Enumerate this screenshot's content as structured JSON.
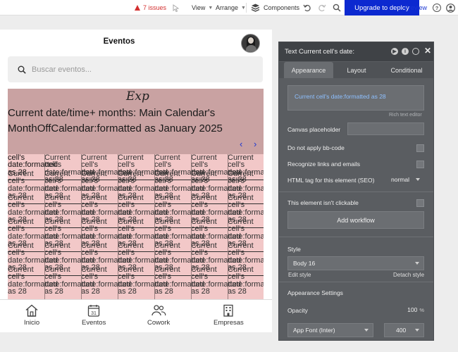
{
  "toolbar": {
    "issues": "7 issues",
    "view": "View",
    "arrange": "Arrange",
    "components": "Components",
    "deploy": "Upgrade to deploy",
    "preview": "Preview"
  },
  "app": {
    "title": "Eventos",
    "search_placeholder": "Buscar eventos...",
    "calendar": {
      "exp_text": "Exp",
      "month_text": "Current date/time+ months: Main Calendar's MonthOffCalendar:formatted as January 2025",
      "prev_arrow": "‹",
      "next_arrow": "›",
      "cell_text": "Current cell's date:formatted as 28",
      "first_cell_text": "cell's date:formatted as 28"
    },
    "bottom_nav": [
      {
        "label": "Inicio",
        "icon": "home-icon"
      },
      {
        "label": "Eventos",
        "icon": "calendar-icon",
        "badge": "31"
      },
      {
        "label": "Cowork",
        "icon": "people-icon"
      },
      {
        "label": "Empresas",
        "icon": "building-icon"
      }
    ]
  },
  "panel": {
    "title": "Text Current cell's date:",
    "tabs": [
      "Appearance",
      "Layout",
      "Conditional"
    ],
    "active_tab": "Appearance",
    "expression": "Current cell's date:formatted as 28",
    "rich_text_editor": "Rich text editor",
    "canvas_placeholder_label": "Canvas placeholder",
    "do_not_apply_bbcode": "Do not apply bb-code",
    "recognize_links": "Recognize links and emails",
    "html_tag_label": "HTML tag for this element (SEO)",
    "html_tag_value": "normal",
    "not_clickable": "This element isn't clickable",
    "add_workflow": "Add workflow",
    "style_label": "Style",
    "style_value": "Body 16",
    "edit_style": "Edit style",
    "detach_style": "Detach style",
    "appearance_settings": "Appearance Settings",
    "opacity_label": "Opacity",
    "opacity_value": "100",
    "opacity_unit": "%",
    "font_value": "App Font (Inter)",
    "font_weight": "400"
  }
}
